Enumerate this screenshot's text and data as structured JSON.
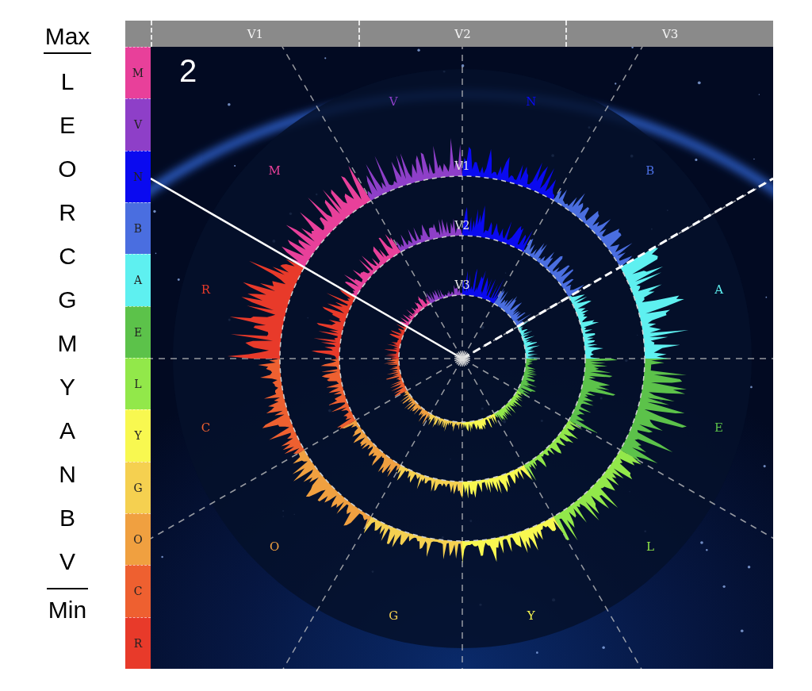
{
  "scale": {
    "top": "Max",
    "items": [
      "L",
      "E",
      "O",
      "R",
      "C",
      "G",
      "M",
      "Y",
      "A",
      "N",
      "B",
      "V"
    ],
    "bottom": "Min"
  },
  "header": {
    "columns": [
      "V1",
      "V2",
      "V3"
    ]
  },
  "legend": [
    {
      "label": "M",
      "color": "#e8409a"
    },
    {
      "label": "V",
      "color": "#8e3fc8"
    },
    {
      "label": "N",
      "color": "#0a0af0"
    },
    {
      "label": "B",
      "color": "#4a6ee0"
    },
    {
      "label": "A",
      "color": "#5ef0f0"
    },
    {
      "label": "E",
      "color": "#5cc24a"
    },
    {
      "label": "L",
      "color": "#92e84a"
    },
    {
      "label": "Y",
      "color": "#f8f850"
    },
    {
      "label": "G",
      "color": "#f5d050"
    },
    {
      "label": "O",
      "color": "#f0a040"
    },
    {
      "label": "C",
      "color": "#ee6030"
    },
    {
      "label": "R",
      "color": "#e83a2a"
    }
  ],
  "panel_number": "2",
  "sectors": [
    {
      "label": "N",
      "color": "#0a0af0"
    },
    {
      "label": "B",
      "color": "#4a6ee0"
    },
    {
      "label": "A",
      "color": "#5ef0f0"
    },
    {
      "label": "E",
      "color": "#5cc24a"
    },
    {
      "label": "L",
      "color": "#92e84a"
    },
    {
      "label": "Y",
      "color": "#f8f850"
    },
    {
      "label": "G",
      "color": "#f5d050"
    },
    {
      "label": "O",
      "color": "#f0a040"
    },
    {
      "label": "C",
      "color": "#ee6030"
    },
    {
      "label": "R",
      "color": "#e83a2a"
    },
    {
      "label": "M",
      "color": "#e8409a"
    },
    {
      "label": "V",
      "color": "#8e3fc8"
    }
  ],
  "rings": [
    {
      "label": "V1"
    },
    {
      "label": "V2"
    },
    {
      "label": "V3"
    }
  ]
}
